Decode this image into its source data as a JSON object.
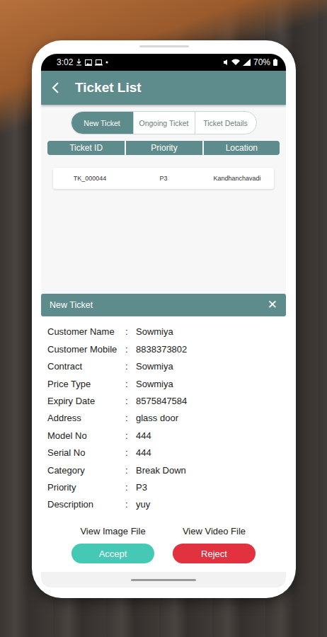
{
  "status_bar": {
    "time": "3:02",
    "battery": "70%"
  },
  "header": {
    "title": "Ticket List"
  },
  "tabs": [
    {
      "label": "New Ticket",
      "selected": true
    },
    {
      "label": "Ongoing Ticket",
      "selected": false
    },
    {
      "label": "Ticket Details",
      "selected": false
    }
  ],
  "table": {
    "columns": [
      "Ticket ID",
      "Priority",
      "Location"
    ],
    "rows": [
      [
        "TK_000044",
        "P3",
        "Kandhanchavadi"
      ]
    ]
  },
  "detail_panel": {
    "title": "New Ticket",
    "close": "✕",
    "separator": ":",
    "fields": [
      {
        "label": "Customer Name",
        "value": "Sowmiya"
      },
      {
        "label": "Customer Mobile",
        "value": "8838373802"
      },
      {
        "label": "Contract",
        "value": "Sowmiya"
      },
      {
        "label": "Price Type",
        "value": "Sowmiya"
      },
      {
        "label": "Expiry Date",
        "value": "8575847584"
      },
      {
        "label": "Address",
        "value": "glass door"
      },
      {
        "label": "Model No",
        "value": "444"
      },
      {
        "label": "Serial No",
        "value": "444"
      },
      {
        "label": "Category",
        "value": "Break Down"
      },
      {
        "label": "Priority",
        "value": "P3"
      },
      {
        "label": "Description",
        "value": "yuy"
      }
    ],
    "links": [
      "View Image File",
      "View Video File"
    ],
    "buttons": [
      {
        "label": "Accept",
        "color": "#45c9b4"
      },
      {
        "label": "Reject",
        "color": "#e2323f"
      }
    ]
  }
}
